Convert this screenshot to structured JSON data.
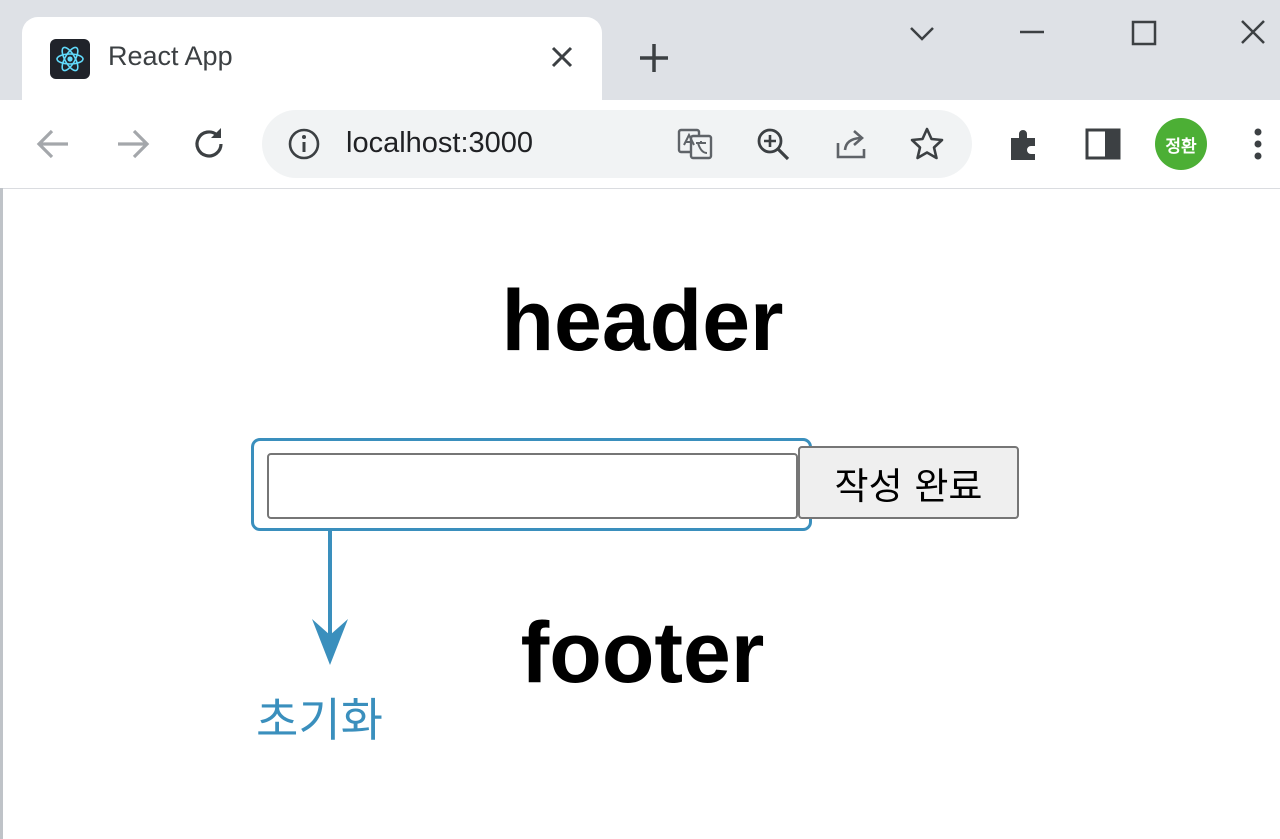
{
  "browser": {
    "tab": {
      "title": "React App"
    },
    "address_bar": {
      "url": "localhost:3000"
    },
    "profile_avatar_text": "정환",
    "profile_color": "#4caf35"
  },
  "page": {
    "header": "header",
    "input": {
      "value": "",
      "placeholder": ""
    },
    "submit_button_label": "작성 완료",
    "footer": "footer"
  },
  "annotation": {
    "reset_label": "초기화",
    "color": "#3a8fbd"
  }
}
